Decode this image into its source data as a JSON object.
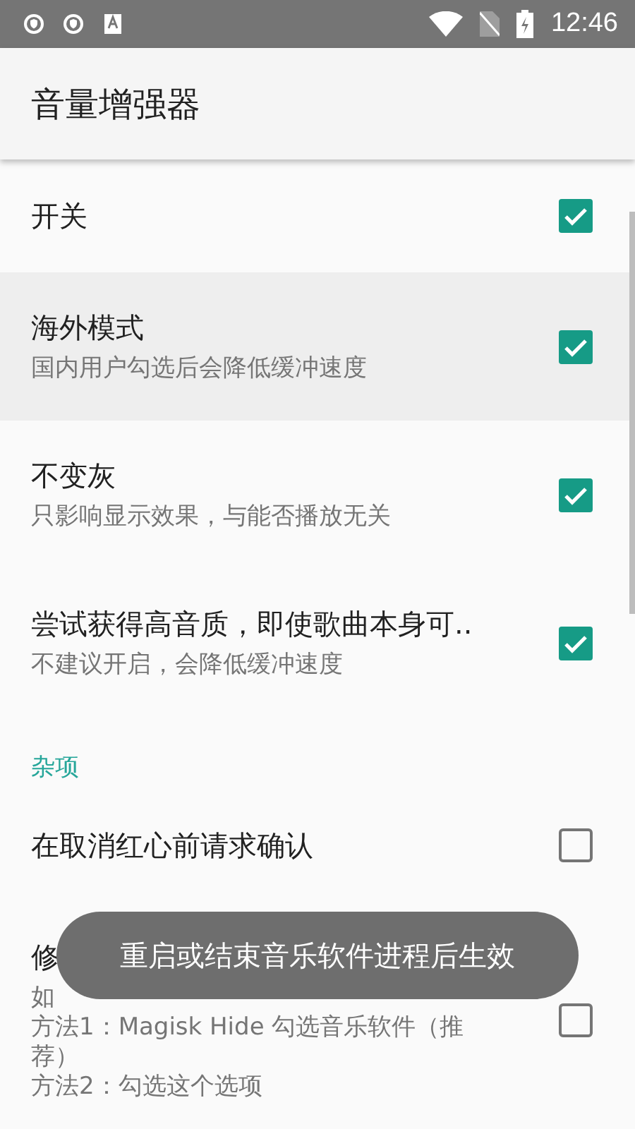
{
  "status_bar": {
    "time": "12:46"
  },
  "app_bar": {
    "title": "音量增强器"
  },
  "preferences": [
    {
      "kind": "checkbox",
      "title": "开关",
      "checked": true,
      "highlighted": false
    },
    {
      "kind": "checkbox",
      "title": "海外模式",
      "summary_lines": [
        "国内用户勾选后会降低缓冲速度"
      ],
      "checked": true,
      "highlighted": true
    },
    {
      "kind": "checkbox",
      "title": "不变灰",
      "summary_lines": [
        "只影响显示效果，与能否播放无关"
      ],
      "checked": true,
      "highlighted": false
    },
    {
      "kind": "checkbox",
      "title": "尝试获得高音质，即使歌曲本身可..",
      "summary_lines": [
        "不建议开启，会降低缓冲速度"
      ],
      "checked": true,
      "highlighted": false
    },
    {
      "kind": "category",
      "title": "杂项"
    },
    {
      "kind": "checkbox",
      "title": "在取消红心前请求确认",
      "checked": false,
      "highlighted": false
    },
    {
      "kind": "checkbox",
      "title": "修",
      "summary_lines": [
        "如",
        "方法1：Magisk Hide 勾选音乐软件（推荐）",
        "方法2：勾选这个选项"
      ],
      "checked": false,
      "highlighted": false
    }
  ],
  "toast": {
    "text": "重启或结束音乐软件进程后生效"
  }
}
